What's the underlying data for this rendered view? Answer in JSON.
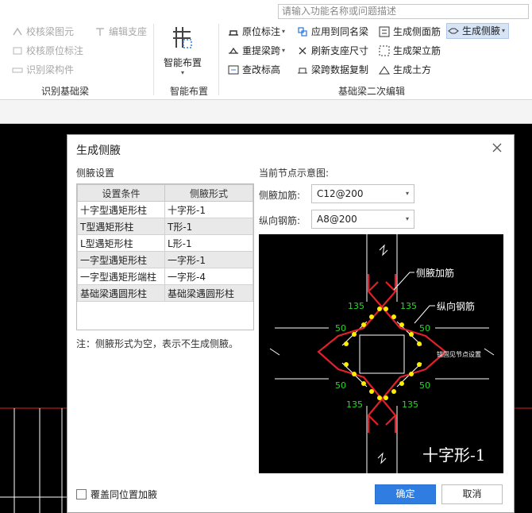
{
  "ribbon": {
    "search_placeholder": "请输入功能名称或问题描述",
    "group1": {
      "items": [
        {
          "label": "校核梁图元",
          "icon": "check-beam-icon"
        },
        {
          "label": "编辑支座",
          "icon": "edit-support-icon"
        },
        {
          "label": "校核原位标注",
          "icon": "check-annotation-icon"
        },
        {
          "label": "识别梁构件",
          "icon": "recognize-beam-icon"
        }
      ],
      "label": "识别基础梁"
    },
    "group2": {
      "big_label": "智能布置",
      "label": "智能布置"
    },
    "group3": {
      "items": [
        {
          "label": "原位标注",
          "icon": "annotation-icon"
        },
        {
          "label": "应用到同名梁",
          "icon": "apply-same-icon"
        },
        {
          "label": "生成侧面筋",
          "icon": "side-rebar-icon"
        },
        {
          "label": "生成侧腋",
          "icon": "side-haunch-icon"
        },
        {
          "label": "重提梁跨",
          "icon": "repick-span-icon"
        },
        {
          "label": "刷新支座尺寸",
          "icon": "refresh-support-icon"
        },
        {
          "label": "生成架立筋",
          "icon": "erect-rebar-icon"
        },
        {
          "label": "查改标高",
          "icon": "elevation-icon"
        },
        {
          "label": "梁跨数据复制",
          "icon": "copy-span-icon"
        },
        {
          "label": "生成土方",
          "icon": "earthwork-icon"
        }
      ],
      "label": "基础梁二次编辑"
    }
  },
  "dialog": {
    "title": "生成侧腋",
    "left_title": "侧腋设置",
    "table": {
      "headers": [
        "设置条件",
        "侧腋形式"
      ],
      "rows": [
        [
          "十字型遇矩形柱",
          "十字形-1"
        ],
        [
          "T型遇矩形柱",
          "T形-1"
        ],
        [
          "L型遇矩形柱",
          "L形-1"
        ],
        [
          "一字型遇矩形柱",
          "一字形-1"
        ],
        [
          "一字型遇矩形端柱",
          "一字形-4"
        ],
        [
          "基础梁遇圆形柱",
          "基础梁遇圆形柱"
        ]
      ]
    },
    "note": "注：侧腋形式为空，表示不生成侧腋。",
    "right_title": "当前节点示意图:",
    "haunch_rebar_label": "侧腋加筋:",
    "haunch_rebar_value": "C12@200",
    "long_rebar_label": "纵向钢筋:",
    "long_rebar_value": "A8@200",
    "diagram": {
      "label_haunch": "侧腋加筋",
      "label_long": "纵向钢筋",
      "angle": "135",
      "dim": "50",
      "ref": "锚固见节点设置",
      "caption": "十字形-1"
    },
    "checkbox_label": "覆盖同位置加腋",
    "ok_label": "确定",
    "cancel_label": "取消"
  },
  "colors": {
    "primary": "#2f7de1",
    "rebar_red": "#e0202a",
    "dot_yellow": "#ffee00",
    "text_green": "#2bd62b"
  }
}
